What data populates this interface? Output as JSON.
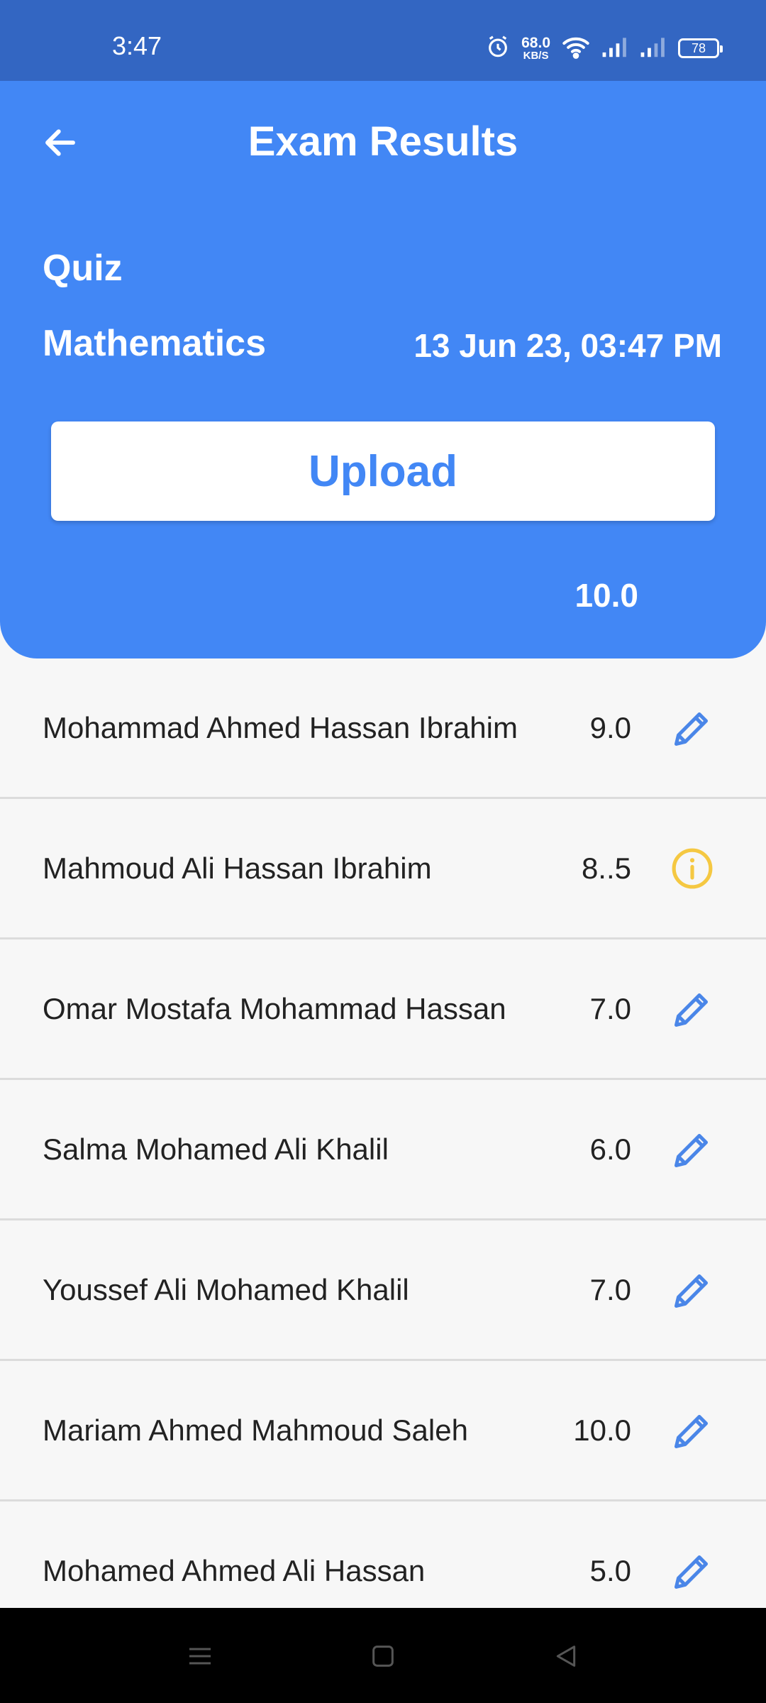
{
  "status_bar": {
    "time": "3:47",
    "net_speed_value": "68.0",
    "net_speed_unit": "KB/S",
    "battery": "78",
    "icons": [
      "alarm-icon",
      "wifi-icon",
      "signal-icon",
      "signal-icon"
    ]
  },
  "header": {
    "title": "Exam Results",
    "exam_type": "Quiz",
    "subject": "Mathematics",
    "datetime": "13 Jun 23, 03:47 PM",
    "upload_label": "Upload",
    "max_score": "10.0",
    "background_color": "#4287f5"
  },
  "students": [
    {
      "name": "Mohammad Ahmed Hassan Ibrahim",
      "score": "9.0",
      "action_icon": "edit-icon"
    },
    {
      "name": "Mahmoud Ali Hassan Ibrahim",
      "score": "8..5",
      "action_icon": "info-icon"
    },
    {
      "name": "Omar Mostafa Mohammad Hassan",
      "score": "7.0",
      "action_icon": "edit-icon"
    },
    {
      "name": "Salma Mohamed Ali Khalil",
      "score": "6.0",
      "action_icon": "edit-icon"
    },
    {
      "name": "Youssef Ali Mohamed Khalil",
      "score": "7.0",
      "action_icon": "edit-icon"
    },
    {
      "name": "Mariam Ahmed Mahmoud Saleh",
      "score": "10.0",
      "action_icon": "edit-icon"
    },
    {
      "name": "Mohamed Ahmed Ali Hassan",
      "score": "5.0",
      "action_icon": "edit-icon"
    }
  ],
  "colors": {
    "edit_icon": "#4a86e8",
    "info_icon": "#f5c842",
    "status_bar": "#3366c2"
  }
}
